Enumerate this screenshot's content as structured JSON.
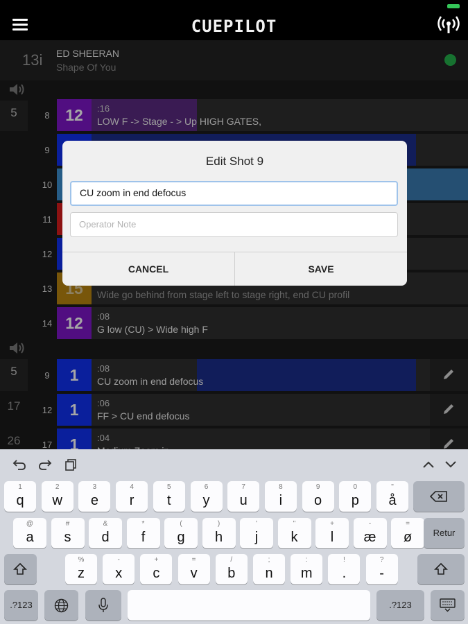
{
  "header": {
    "brand": "CUEPILOT",
    "menu_icon": "hamburger-icon",
    "signal_icon": "broadcast-icon"
  },
  "song": {
    "number": "13i",
    "artist": "ED SHEERAN",
    "title": "Shape Of You",
    "status_color": "#24b04a"
  },
  "upper_list": {
    "line_number": "5",
    "rows": [
      {
        "shot": "8",
        "camera": "12",
        "color": "#7d16c6",
        "duration": ":16",
        "description": "LOW F -> Stage - > Up HIGH GATES,"
      },
      {
        "shot": "9",
        "camera": "",
        "color": "#1030f0",
        "duration": "",
        "description": ""
      },
      {
        "shot": "10",
        "camera": "",
        "color": "#3d8fd0",
        "duration": "",
        "description": ""
      },
      {
        "shot": "11",
        "camera": "",
        "color": "#d81c1c",
        "duration": "",
        "description": ""
      },
      {
        "shot": "12",
        "camera": "",
        "color": "#1030f0",
        "duration": "",
        "description": ""
      },
      {
        "shot": "13",
        "camera": "15",
        "color": "#b88410",
        "duration": "",
        "description": "Wide go behind from stage left to stage right, end CU profil"
      },
      {
        "shot": "14",
        "camera": "12",
        "color": "#7d16c6",
        "duration": ":08",
        "description": "G low (CU) > Wide high F"
      }
    ]
  },
  "lower_list": {
    "rows": [
      {
        "line_number": "5",
        "shot": "9",
        "camera": "1",
        "color": "#1030f0",
        "duration": ":08",
        "description": "CU zoom in end defocus"
      },
      {
        "line_number": "17",
        "shot": "12",
        "camera": "1",
        "color": "#1030f0",
        "duration": ":06",
        "description": "FF > CU end defocus"
      },
      {
        "line_number": "26",
        "shot": "17",
        "camera": "1",
        "color": "#1030f0",
        "duration": ":04",
        "description": "Medium Zoom in"
      }
    ]
  },
  "dialog": {
    "title": "Edit Shot 9",
    "shot_value": "CU zoom in end defocus",
    "note_placeholder": "Operator Note",
    "cancel_label": "CANCEL",
    "save_label": "SAVE"
  },
  "keyboard": {
    "row1": [
      {
        "m": "q",
        "s": "1"
      },
      {
        "m": "w",
        "s": "2"
      },
      {
        "m": "e",
        "s": "3"
      },
      {
        "m": "r",
        "s": "4"
      },
      {
        "m": "t",
        "s": "5"
      },
      {
        "m": "y",
        "s": "6"
      },
      {
        "m": "u",
        "s": "7"
      },
      {
        "m": "i",
        "s": "8"
      },
      {
        "m": "o",
        "s": "9"
      },
      {
        "m": "p",
        "s": "0"
      },
      {
        "m": "å",
        "s": "\""
      }
    ],
    "row2": [
      {
        "m": "a",
        "s": "@"
      },
      {
        "m": "s",
        "s": "#"
      },
      {
        "m": "d",
        "s": "&"
      },
      {
        "m": "f",
        "s": "*"
      },
      {
        "m": "g",
        "s": "("
      },
      {
        "m": "h",
        "s": ")"
      },
      {
        "m": "j",
        "s": "'"
      },
      {
        "m": "k",
        "s": "\""
      },
      {
        "m": "l",
        "s": "+"
      },
      {
        "m": "æ",
        "s": "-"
      },
      {
        "m": "ø",
        "s": "="
      }
    ],
    "row3": [
      {
        "m": "z",
        "s": "%"
      },
      {
        "m": "x",
        "s": "-"
      },
      {
        "m": "c",
        "s": "+"
      },
      {
        "m": "v",
        "s": "="
      },
      {
        "m": "b",
        "s": "/"
      },
      {
        "m": "n",
        "s": ";"
      },
      {
        "m": "m",
        "s": ":"
      },
      {
        "m": ".",
        "s": "!"
      },
      {
        "m": "-",
        "s": "?"
      }
    ],
    "return_label": "Retur",
    "numbers_label": ".?123",
    "globe_icon": "globe-icon",
    "mic_icon": "microphone-icon",
    "hide_icon": "keyboard-hide-icon"
  }
}
